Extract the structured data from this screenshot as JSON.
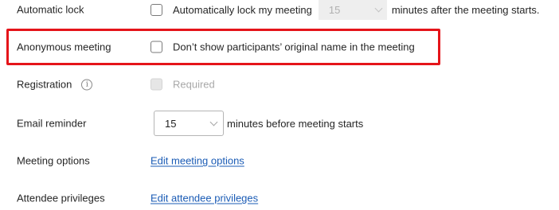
{
  "settings": {
    "automatic_lock": {
      "label": "Automatically lock my meeting",
      "row_label": "Automatic lock",
      "minutes_value": "15",
      "after_text": "minutes after the meeting starts.",
      "checked": false
    },
    "anonymous_meeting": {
      "row_label": "Anonymous meeting",
      "label": "Don’t show participants’ original name in the meeting",
      "checked": false,
      "highlighted": true,
      "highlight_color": "#e5141a"
    },
    "registration": {
      "row_label": "Registration",
      "info_glyph": "i",
      "label": "Required",
      "disabled": true
    },
    "email_reminder": {
      "row_label": "Email reminder",
      "minutes_value": "15",
      "after_text": "minutes before meeting starts"
    },
    "meeting_options": {
      "row_label": "Meeting options",
      "link_text": "Edit meeting options"
    },
    "attendee_privileges": {
      "row_label": "Attendee privileges",
      "link_text": "Edit attendee privileges"
    }
  },
  "colors": {
    "link": "#1a5bb5",
    "text": "#262626",
    "disabled_text": "#a8a8a8",
    "highlight": "#e5141a"
  },
  "icons": {
    "info": "info-icon",
    "dropdown": "chevron-down-icon"
  }
}
